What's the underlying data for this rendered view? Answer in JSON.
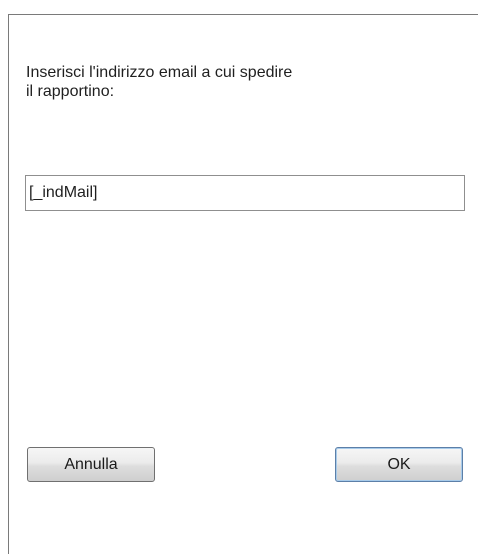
{
  "dialog": {
    "prompt": "Inserisci l'indirizzo email a cui spedire\nil rapportino:",
    "email_value": "[_indMail]",
    "cancel_label": "Annulla",
    "ok_label": "OK"
  },
  "colors": {
    "background": "#ffffff",
    "frame_border": "#7a7a7a",
    "input_border": "#8f8f8f",
    "button_border": "#707070",
    "ok_focus_border": "#5c7fa8"
  }
}
